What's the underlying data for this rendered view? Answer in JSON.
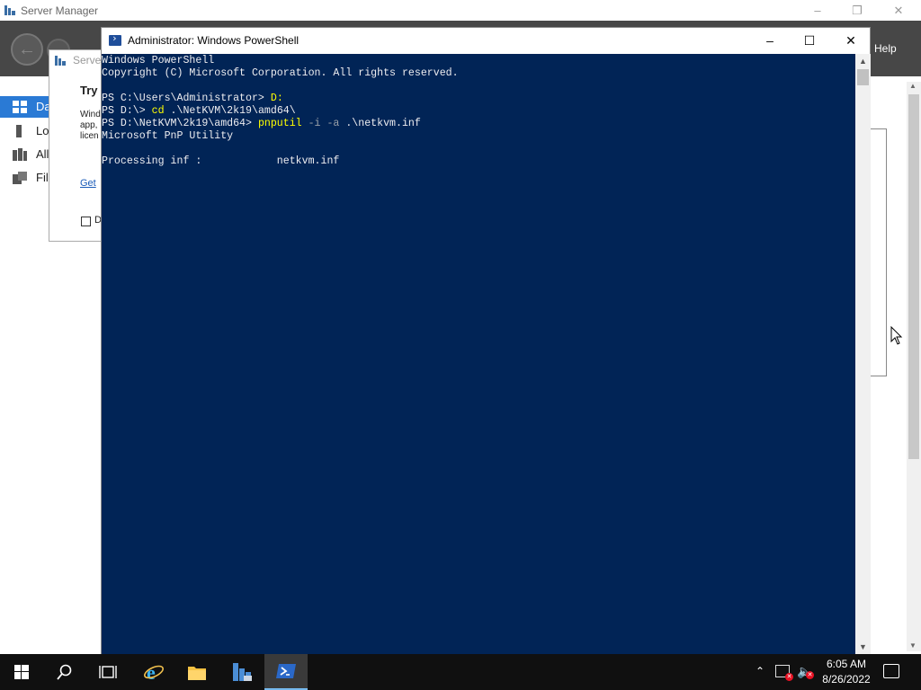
{
  "server_manager": {
    "title": "Server Manager",
    "help_label": "Help",
    "sidebar": {
      "items": [
        {
          "label": "Da",
          "icon": "dashboard-icon"
        },
        {
          "label": "Lo",
          "icon": "local-server-icon"
        },
        {
          "label": "All",
          "icon": "all-servers-icon"
        },
        {
          "label": "File",
          "icon": "file-services-icon"
        }
      ]
    },
    "dialog": {
      "title": "Server",
      "heading": "Try",
      "body_lines": [
        "Wind",
        "app,",
        "licen"
      ],
      "link": "Get",
      "checkbox_label": "D"
    }
  },
  "powershell": {
    "title": "Administrator: Windows PowerShell",
    "console_lines": [
      {
        "segments": [
          {
            "text": "Windows PowerShell",
            "color": "white"
          }
        ]
      },
      {
        "segments": [
          {
            "text": "Copyright (C) Microsoft Corporation. All rights reserved.",
            "color": "white"
          }
        ]
      },
      {
        "segments": [
          {
            "text": "",
            "color": "white"
          }
        ]
      },
      {
        "segments": [
          {
            "text": "PS C:\\Users\\Administrator> ",
            "color": "white"
          },
          {
            "text": "D:",
            "color": "yellow"
          }
        ]
      },
      {
        "segments": [
          {
            "text": "PS D:\\> ",
            "color": "white"
          },
          {
            "text": "cd",
            "color": "yellow"
          },
          {
            "text": " .\\NetKVM\\2k19\\amd64\\",
            "color": "white"
          }
        ]
      },
      {
        "segments": [
          {
            "text": "PS D:\\NetKVM\\2k19\\amd64> ",
            "color": "white"
          },
          {
            "text": "pnputil",
            "color": "yellow"
          },
          {
            "text": " -i -a",
            "color": "gray"
          },
          {
            "text": " .\\netkvm.inf",
            "color": "white"
          }
        ]
      },
      {
        "segments": [
          {
            "text": "Microsoft PnP Utility",
            "color": "white"
          }
        ]
      },
      {
        "segments": [
          {
            "text": "",
            "color": "white"
          }
        ]
      },
      {
        "segments": [
          {
            "text": "Processing inf :            netkvm.inf",
            "color": "white"
          }
        ]
      }
    ]
  },
  "taskbar": {
    "buttons": [
      {
        "name": "start-button",
        "icon": "windows-logo-icon"
      },
      {
        "name": "search-button",
        "icon": "search-icon"
      },
      {
        "name": "task-view-button",
        "icon": "task-view-icon"
      },
      {
        "name": "internet-explorer-button",
        "icon": "internet-explorer-icon"
      },
      {
        "name": "file-explorer-button",
        "icon": "folder-icon"
      },
      {
        "name": "server-manager-button",
        "icon": "server-manager-icon"
      },
      {
        "name": "powershell-button",
        "icon": "powershell-icon",
        "active": true
      }
    ],
    "tray": {
      "time": "6:05 AM",
      "date": "8/26/2022"
    }
  },
  "colors": {
    "console_bg": "#012456",
    "console_fg": "#eeedf0",
    "console_command": "#ffff00",
    "console_param": "#9aa0a8",
    "taskbar_bg": "#101010",
    "accent": "#2a7ad5"
  }
}
